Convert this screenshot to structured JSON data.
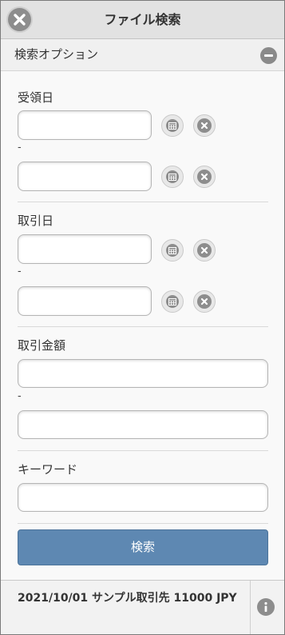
{
  "header": {
    "title": "ファイル検索",
    "close_icon": "close-icon"
  },
  "options": {
    "label": "検索オプション",
    "collapse_icon": "minus-icon"
  },
  "fields": {
    "received_date": {
      "label": "受領日",
      "separator": "-",
      "from": "",
      "to": ""
    },
    "transaction_date": {
      "label": "取引日",
      "separator": "-",
      "from": "",
      "to": ""
    },
    "amount": {
      "label": "取引金額",
      "separator": "-",
      "from": "",
      "to": ""
    },
    "keyword": {
      "label": "キーワード",
      "value": ""
    }
  },
  "icons": {
    "calendar": "calendar-icon",
    "clear": "clear-icon",
    "info": "info-icon"
  },
  "search_button": {
    "label": "検索"
  },
  "results": [
    {
      "text": "2021/10/01 サンプル取引先 11000 JPY"
    }
  ],
  "colors": {
    "primary": "#5e88b2",
    "header_bg": "#e2e2e2",
    "icon": "#8d8d8d"
  }
}
